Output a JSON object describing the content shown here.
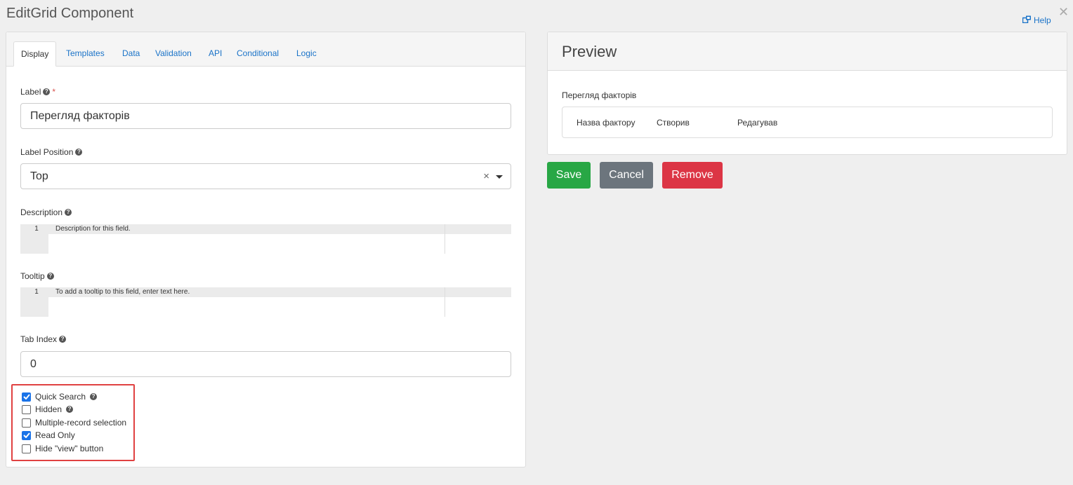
{
  "dialog": {
    "title": "EditGrid Component",
    "help_label": "Help"
  },
  "tabs": [
    {
      "label": "Display",
      "active": true
    },
    {
      "label": "Templates",
      "active": false
    },
    {
      "label": "Data",
      "active": false
    },
    {
      "label": "Validation",
      "active": false
    },
    {
      "label": "API",
      "active": false
    },
    {
      "label": "Conditional",
      "active": false
    },
    {
      "label": "Logic",
      "active": false
    }
  ],
  "form": {
    "label": {
      "title": "Label",
      "required_mark": "*",
      "value": "Перегляд факторів"
    },
    "label_position": {
      "title": "Label Position",
      "value": "Top",
      "clear_glyph": "×"
    },
    "description": {
      "title": "Description",
      "line_number": "1",
      "placeholder": "Description for this field."
    },
    "tooltip": {
      "title": "Tooltip",
      "line_number": "1",
      "placeholder": "To add a tooltip to this field, enter text here."
    },
    "tab_index": {
      "title": "Tab Index",
      "value": "0"
    },
    "checkboxes": [
      {
        "label": "Quick Search",
        "checked": true,
        "has_help": true
      },
      {
        "label": "Hidden",
        "checked": false,
        "has_help": true
      },
      {
        "label": "Multiple-record selection",
        "checked": false,
        "has_help": false
      },
      {
        "label": "Read Only",
        "checked": true,
        "has_help": false
      },
      {
        "label": "Hide \"view\" button",
        "checked": false,
        "has_help": false
      }
    ]
  },
  "preview": {
    "title": "Preview",
    "field_label": "Перегляд факторів",
    "columns": [
      "Назва фактору",
      "Створив",
      "Редагував"
    ]
  },
  "actions": {
    "save": "Save",
    "cancel": "Cancel",
    "remove": "Remove"
  },
  "colors": {
    "accent": "#1a73c8",
    "save": "#28a745",
    "cancel": "#6c757d",
    "remove": "#dc3545",
    "highlight_box": "#e04141"
  }
}
